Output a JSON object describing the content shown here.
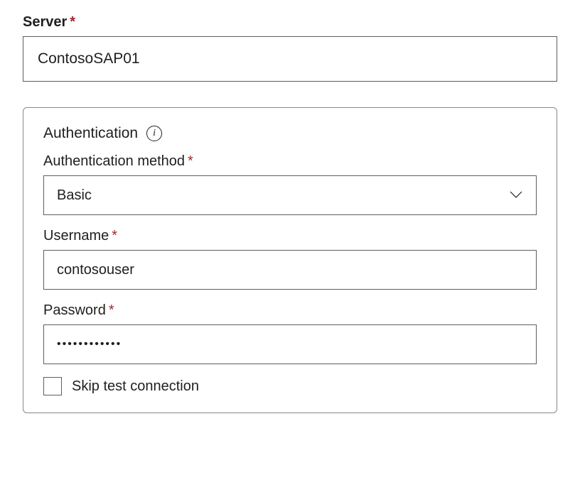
{
  "server": {
    "label": "Server",
    "value": "ContosoSAP01"
  },
  "authentication": {
    "panel_title": "Authentication",
    "method": {
      "label": "Authentication method",
      "selected": "Basic"
    },
    "username": {
      "label": "Username",
      "value": "contosouser"
    },
    "password": {
      "label": "Password",
      "value": "••••••••••••"
    },
    "skip_test": {
      "label": "Skip test connection",
      "checked": false
    }
  }
}
